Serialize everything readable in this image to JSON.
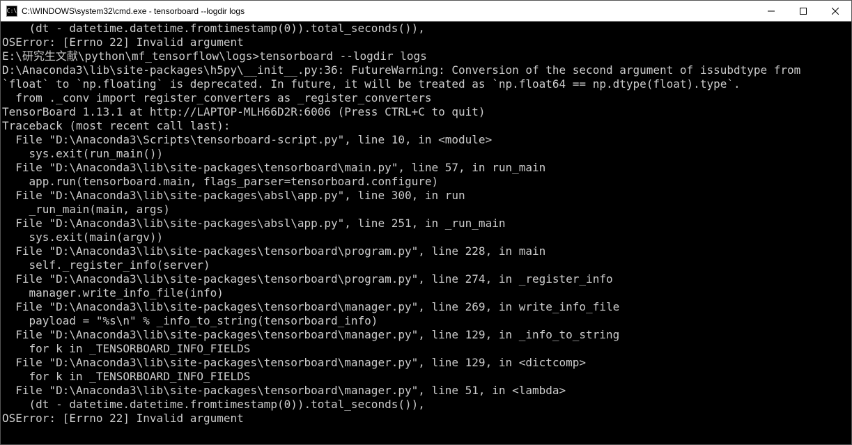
{
  "window": {
    "title": "C:\\WINDOWS\\system32\\cmd.exe - tensorboard  --logdir logs",
    "icon_label": "C:\\"
  },
  "terminal": {
    "lines": [
      "    (dt - datetime.datetime.fromtimestamp(0)).total_seconds()),",
      "OSError: [Errno 22] Invalid argument",
      "",
      "E:\\研究生文献\\python\\mf_tensorflow\\logs>tensorboard --logdir logs",
      "D:\\Anaconda3\\lib\\site-packages\\h5py\\__init__.py:36: FutureWarning: Conversion of the second argument of issubdtype from",
      "`float` to `np.floating` is deprecated. In future, it will be treated as `np.float64 == np.dtype(float).type`.",
      "  from ._conv import register_converters as _register_converters",
      "TensorBoard 1.13.1 at http://LAPTOP-MLH66D2R:6006 (Press CTRL+C to quit)",
      "Traceback (most recent call last):",
      "  File \"D:\\Anaconda3\\Scripts\\tensorboard-script.py\", line 10, in <module>",
      "    sys.exit(run_main())",
      "  File \"D:\\Anaconda3\\lib\\site-packages\\tensorboard\\main.py\", line 57, in run_main",
      "    app.run(tensorboard.main, flags_parser=tensorboard.configure)",
      "  File \"D:\\Anaconda3\\lib\\site-packages\\absl\\app.py\", line 300, in run",
      "    _run_main(main, args)",
      "  File \"D:\\Anaconda3\\lib\\site-packages\\absl\\app.py\", line 251, in _run_main",
      "    sys.exit(main(argv))",
      "  File \"D:\\Anaconda3\\lib\\site-packages\\tensorboard\\program.py\", line 228, in main",
      "    self._register_info(server)",
      "  File \"D:\\Anaconda3\\lib\\site-packages\\tensorboard\\program.py\", line 274, in _register_info",
      "    manager.write_info_file(info)",
      "  File \"D:\\Anaconda3\\lib\\site-packages\\tensorboard\\manager.py\", line 269, in write_info_file",
      "    payload = \"%s\\n\" % _info_to_string(tensorboard_info)",
      "  File \"D:\\Anaconda3\\lib\\site-packages\\tensorboard\\manager.py\", line 129, in _info_to_string",
      "    for k in _TENSORBOARD_INFO_FIELDS",
      "  File \"D:\\Anaconda3\\lib\\site-packages\\tensorboard\\manager.py\", line 129, in <dictcomp>",
      "    for k in _TENSORBOARD_INFO_FIELDS",
      "  File \"D:\\Anaconda3\\lib\\site-packages\\tensorboard\\manager.py\", line 51, in <lambda>",
      "    (dt - datetime.datetime.fromtimestamp(0)).total_seconds()),",
      "OSError: [Errno 22] Invalid argument"
    ]
  }
}
